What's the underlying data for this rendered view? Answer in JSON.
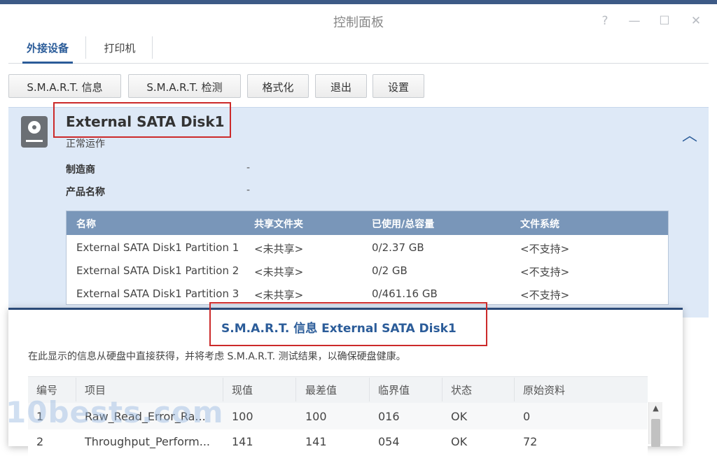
{
  "window": {
    "title": "控制面板",
    "controls": {
      "help": "?",
      "minimize": "—",
      "maximize": "☐",
      "close": "✕"
    }
  },
  "tabs": [
    {
      "label": "外接设备",
      "active": true
    },
    {
      "label": "打印机",
      "active": false
    }
  ],
  "toolbar": {
    "smart_info": "S.M.A.R.T. 信息",
    "smart_test": "S.M.A.R.T. 检测",
    "format": "格式化",
    "eject": "退出",
    "settings": "设置"
  },
  "device": {
    "name": "External SATA Disk1",
    "status": "正常运作",
    "manufacturer_label": "制造商",
    "manufacturer_value": "-",
    "product_label": "产品名称",
    "product_value": "-",
    "icon": "hard-disk-icon"
  },
  "partitions": {
    "headers": [
      "名称",
      "共享文件夹",
      "已使用/总容量",
      "文件系统"
    ],
    "rows": [
      {
        "name": "External SATA Disk1 Partition 1",
        "share": "<未共享>",
        "usage": "0/2.37 GB",
        "fs": "<不支持>"
      },
      {
        "name": "External SATA Disk1 Partition 2",
        "share": "<未共享>",
        "usage": "0/2 GB",
        "fs": "<不支持>"
      },
      {
        "name": "External SATA Disk1 Partition 3",
        "share": "<未共享>",
        "usage": "0/461.16 GB",
        "fs": "<不支持>"
      }
    ]
  },
  "smart_dialog": {
    "title": "S.M.A.R.T. 信息 External SATA Disk1",
    "description": "在此显示的信息从硬盘中直接获得，并将考虑 S.M.A.R.T. 测试结果，以确保硬盘健康。",
    "headers": [
      "编号",
      "项目",
      "现值",
      "最差值",
      "临界值",
      "状态",
      "原始资料"
    ],
    "rows": [
      {
        "id": "1",
        "item": "Raw_Read_Error_Ra...",
        "value": "100",
        "worst": "100",
        "threshold": "016",
        "status": "OK",
        "raw": "0"
      },
      {
        "id": "2",
        "item": "Throughput_Perform...",
        "value": "141",
        "worst": "141",
        "threshold": "054",
        "status": "OK",
        "raw": "72"
      }
    ]
  },
  "watermark": "10bests.com",
  "colors": {
    "accent": "#2b5c99",
    "panel": "#dee9f7",
    "table_header": "#7996b9",
    "highlight_box": "#cc2a2a"
  }
}
